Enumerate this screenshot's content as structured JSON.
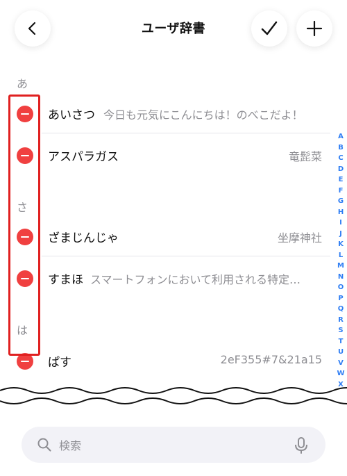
{
  "header": {
    "title": "ユーザ辞書",
    "back_icon": "chevron-left-icon",
    "confirm_icon": "checkmark-icon",
    "add_icon": "plus-icon"
  },
  "sections": [
    {
      "header": "あ",
      "rows": [
        {
          "word": "あいさつ",
          "reading": "今日も元気にこんにちは！のべこだよ！"
        },
        {
          "word": "アスパラガス",
          "reading": "竜髭菜"
        }
      ]
    },
    {
      "header": "さ",
      "rows": [
        {
          "word": "ざまじんじゃ",
          "reading": "坐摩神社"
        },
        {
          "word": "すまほ",
          "reading": "スマートフォンにおいて利用される特定…"
        }
      ]
    },
    {
      "header": "は",
      "rows": [
        {
          "word": "ぱす",
          "reading": "2eF355#7&21a15"
        }
      ]
    }
  ],
  "index_letters": [
    "A",
    "B",
    "C",
    "D",
    "E",
    "F",
    "G",
    "H",
    "I",
    "J",
    "K",
    "L",
    "M",
    "N",
    "O",
    "P",
    "Q",
    "R",
    "S",
    "T",
    "U",
    "V",
    "W",
    "X"
  ],
  "search": {
    "placeholder": "検索"
  },
  "colors": {
    "delete": "#f04040",
    "highlight": "#e02020",
    "index": "#2f7ef4"
  }
}
